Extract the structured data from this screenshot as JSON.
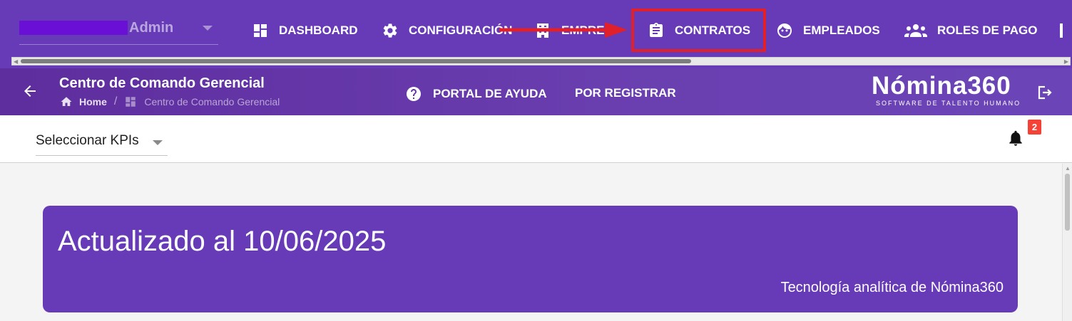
{
  "nav": {
    "user_role": "Admin",
    "items": [
      {
        "label": "DASHBOARD",
        "icon": "dashboard-icon"
      },
      {
        "label": "CONFIGURACIÓN",
        "icon": "gear-icon"
      },
      {
        "label": "EMPRESA",
        "icon": "building-icon"
      },
      {
        "label": "CONTRATOS",
        "icon": "clipboard-icon"
      },
      {
        "label": "EMPLEADOS",
        "icon": "face-icon"
      },
      {
        "label": "ROLES DE PAGO",
        "icon": "people-icon"
      }
    ],
    "highlight_color": "#e0202a"
  },
  "header": {
    "title": "Centro de Comando Gerencial",
    "breadcrumb": {
      "home": "Home",
      "separator": "/",
      "current": "Centro de Comando Gerencial"
    },
    "help_label": "PORTAL DE AYUDA",
    "register_label": "POR REGISTRAR",
    "brand_name": "Nómina360",
    "brand_tagline": "SOFTWARE DE TALENTO HUMANO"
  },
  "toolbar": {
    "kpi_select_label": "Seleccionar KPIs",
    "notification_count": "2"
  },
  "banner": {
    "title": "Actualizado al 10/06/2025",
    "subtitle": "Tecnología analítica de Nómina360"
  },
  "colors": {
    "primary": "#673ab7",
    "badge": "#f44336"
  }
}
